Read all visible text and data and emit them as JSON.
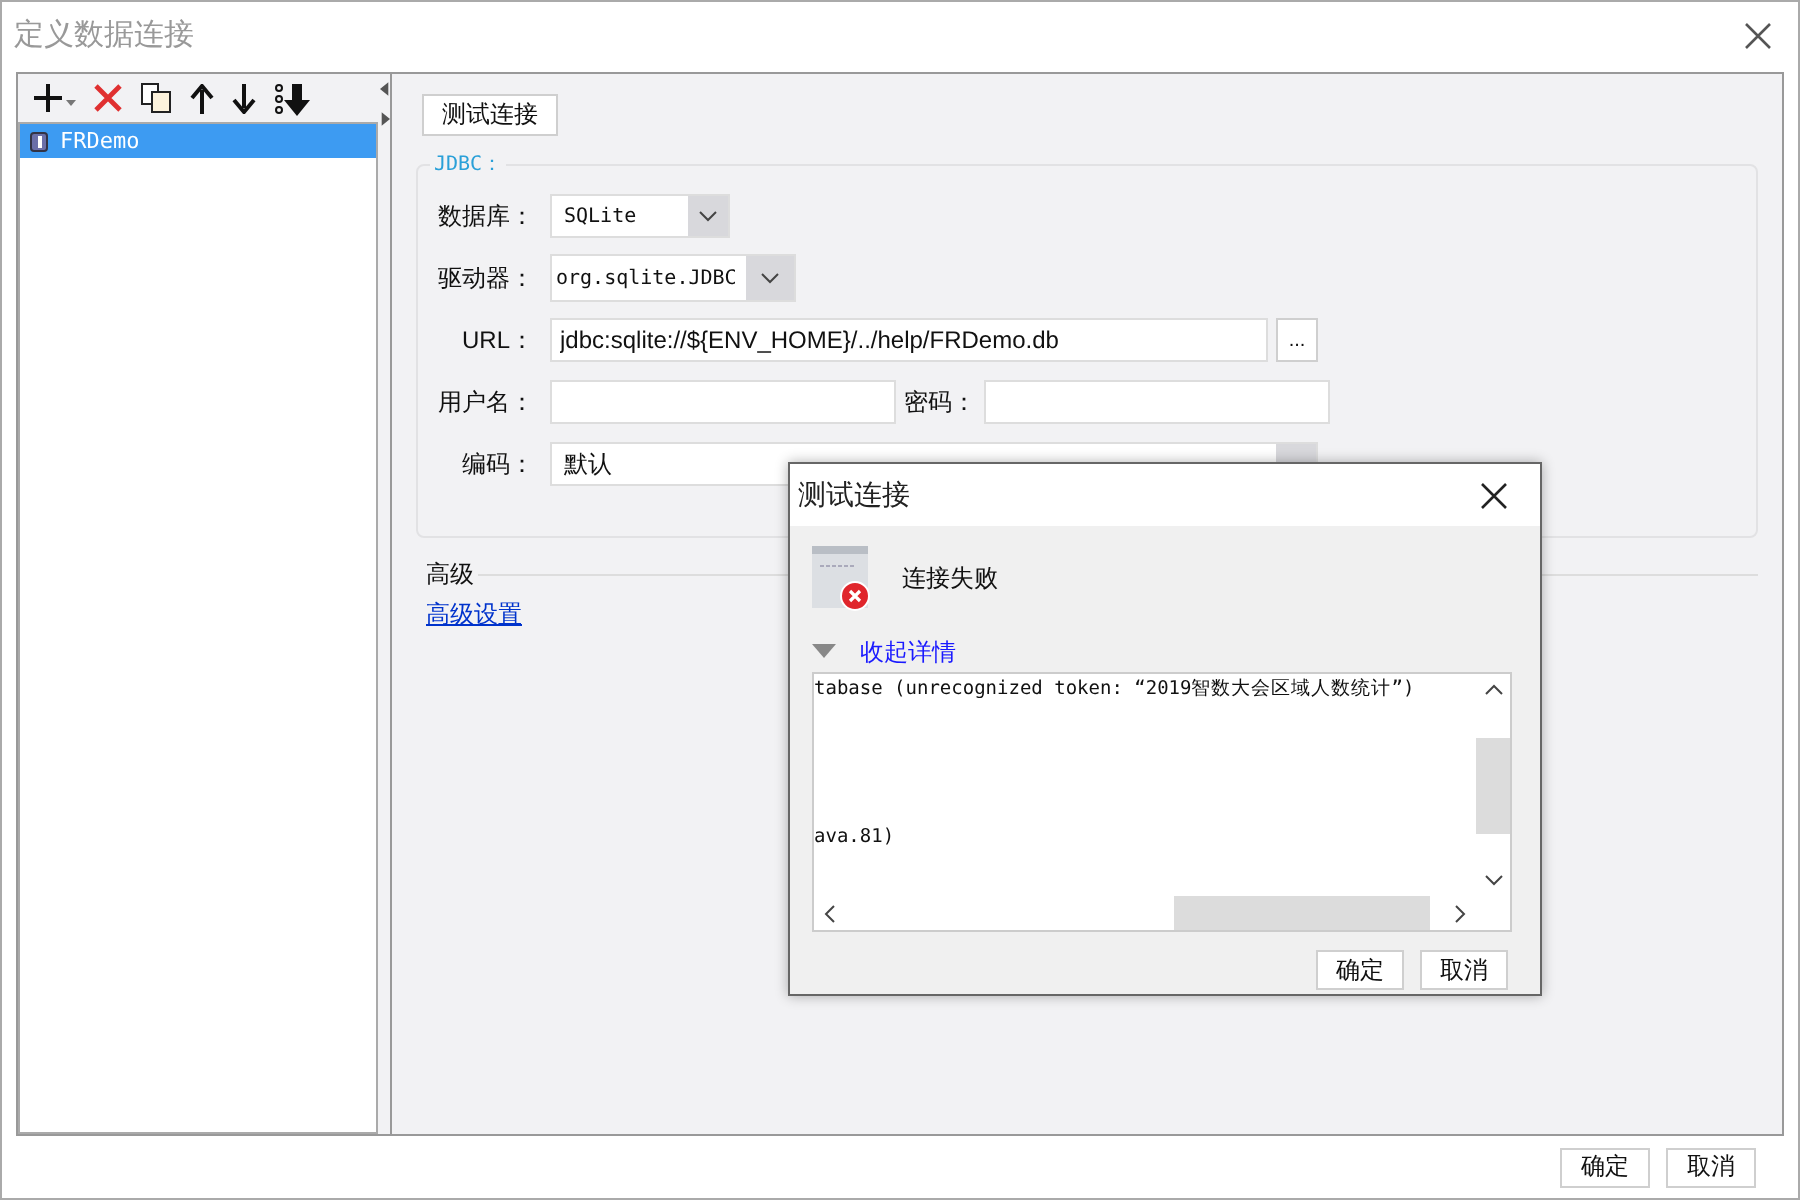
{
  "window": {
    "title": "定义数据连接"
  },
  "connections": [
    {
      "name": "FRDemo",
      "selected": true
    }
  ],
  "test_button": "测试连接",
  "jdbc": {
    "legend": "JDBC：",
    "database": {
      "label": "数据库：",
      "value": "SQLite"
    },
    "driver": {
      "label": "驱动器：",
      "value": "org.sqlite.JDBC"
    },
    "url": {
      "label": "URL：",
      "value": "jdbc:sqlite://${ENV_HOME}/../help/FRDemo.db",
      "browse": "..."
    },
    "username": {
      "label": "用户名："
    },
    "password": {
      "label": "密码："
    },
    "encoding": {
      "label": "编码：",
      "value": "默认"
    }
  },
  "advanced": {
    "heading": "高级",
    "link": "高级设置"
  },
  "buttons": [
    "确定",
    "取消"
  ],
  "dialog": {
    "title": "测试连接",
    "message": "连接失败",
    "details_toggle": {
      "label": "收起详情",
      "expanded": true
    },
    "log_top": "tabase (unrecognized token: “2019智数大会区域人数统计”)",
    "log_bottom": "ava.81)",
    "buttons": [
      "确定",
      "取消"
    ]
  }
}
